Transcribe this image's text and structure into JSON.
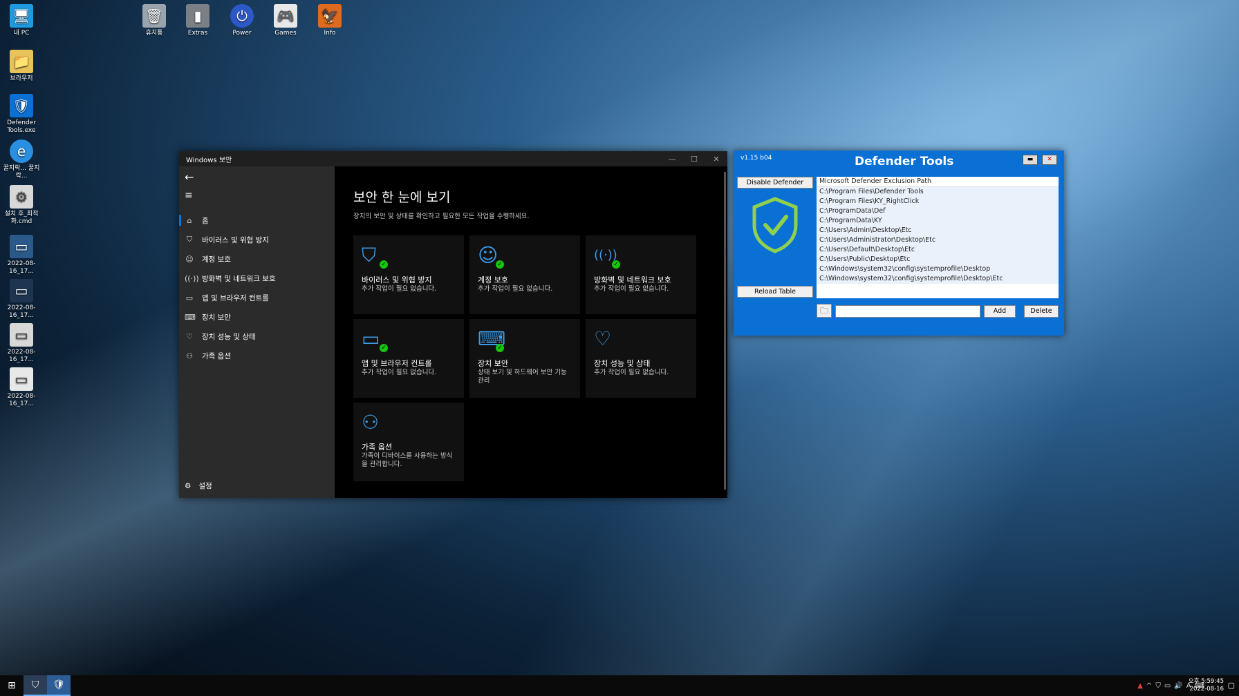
{
  "desktop": {
    "icons_left": [
      {
        "label": "내 PC",
        "icon": "monitor-icon"
      },
      {
        "label": "브라우저",
        "icon": "folder-icon"
      },
      {
        "label": "Defender Tools.exe",
        "icon": "shield-icon"
      },
      {
        "label": "꿀지락... 꿀지락...",
        "icon": "ie-icon"
      },
      {
        "label": "설치 후_최적화.cmd",
        "icon": "gear-icon"
      },
      {
        "label": "2022-08-16_17...",
        "icon": "image-icon"
      },
      {
        "label": "2022-08-16_17...",
        "icon": "image-icon"
      },
      {
        "label": "2022-08-16_17...",
        "icon": "image-icon"
      },
      {
        "label": "2022-08-16_17...",
        "icon": "image-icon"
      }
    ],
    "icons_top": [
      {
        "label": "휴지통",
        "icon": "recycle-bin-icon"
      },
      {
        "label": "Extras",
        "icon": "extras-icon"
      },
      {
        "label": "Power",
        "icon": "power-icon"
      },
      {
        "label": "Games",
        "icon": "gamepad-icon"
      },
      {
        "label": "Info",
        "icon": "info-icon"
      }
    ]
  },
  "winsec": {
    "title": "Windows 보안",
    "nav": [
      {
        "label": "홈",
        "icon": "home-icon"
      },
      {
        "label": "바이러스 및 위협 방지",
        "icon": "shield-icon"
      },
      {
        "label": "계정 보호",
        "icon": "person-icon"
      },
      {
        "label": "방화벽 및 네트워크 보호",
        "icon": "antenna-icon"
      },
      {
        "label": "앱 및 브라우저 컨트롤",
        "icon": "window-icon"
      },
      {
        "label": "장치 보안",
        "icon": "laptop-icon"
      },
      {
        "label": "장치 성능 및 상태",
        "icon": "heart-icon"
      },
      {
        "label": "가족 옵션",
        "icon": "family-icon"
      }
    ],
    "settings_label": "설정",
    "page_title": "보안 한 눈에 보기",
    "page_subtitle": "장치의 보안 및 상태를 확인하고 필요한 모든 작업을 수행하세요.",
    "tiles": [
      {
        "title": "바이러스 및 위협 방지",
        "status": "추가 작업이 필요 없습니다.",
        "icon": "shield-icon"
      },
      {
        "title": "계정 보호",
        "status": "추가 작업이 필요 없습니다.",
        "icon": "person-icon"
      },
      {
        "title": "방화벽 및 네트워크 보호",
        "status": "추가 작업이 필요 없습니다.",
        "icon": "antenna-icon"
      },
      {
        "title": "앱 및 브라우저 컨트롤",
        "status": "추가 작업이 필요 없습니다.",
        "icon": "window-icon"
      },
      {
        "title": "장치 보안",
        "status": "상태 보기 및 하드웨어 보안 기능 관리",
        "icon": "laptop-icon"
      },
      {
        "title": "장치 성능 및 상태",
        "status": "추가 작업이 필요 없습니다.",
        "icon": "heart-icon"
      },
      {
        "title": "가족 옵션",
        "status": "가족이 디바이스를 사용하는 방식을 관리합니다.",
        "icon": "family-icon"
      }
    ]
  },
  "defender_tools": {
    "version": "v1.15 b04",
    "title": "Defender Tools",
    "disable_button": "Disable Defender",
    "reload_button": "Reload Table",
    "list_header": "Microsoft Defender Exclusion Path",
    "paths": [
      "C:\\Program Files\\Defender Tools",
      "C:\\Program Files\\KY_RightClick",
      "C:\\ProgramData\\Def",
      "C:\\ProgramData\\KY",
      "C:\\Users\\Admin\\Desktop\\Etc",
      "C:\\Users\\Administrator\\Desktop\\Etc",
      "C:\\Users\\Default\\Desktop\\Etc",
      "C:\\Users\\Public\\Desktop\\Etc",
      "C:\\Windows\\system32\\config\\systemprofile\\Desktop",
      "C:\\Windows\\system32\\config\\systemprofile\\Desktop\\Etc"
    ],
    "path_input": "",
    "add_button": "Add",
    "delete_button": "Delete"
  },
  "taskbar": {
    "clock_time": "오후 5:59:45",
    "clock_date": "2022-08-16",
    "ime": "A"
  }
}
